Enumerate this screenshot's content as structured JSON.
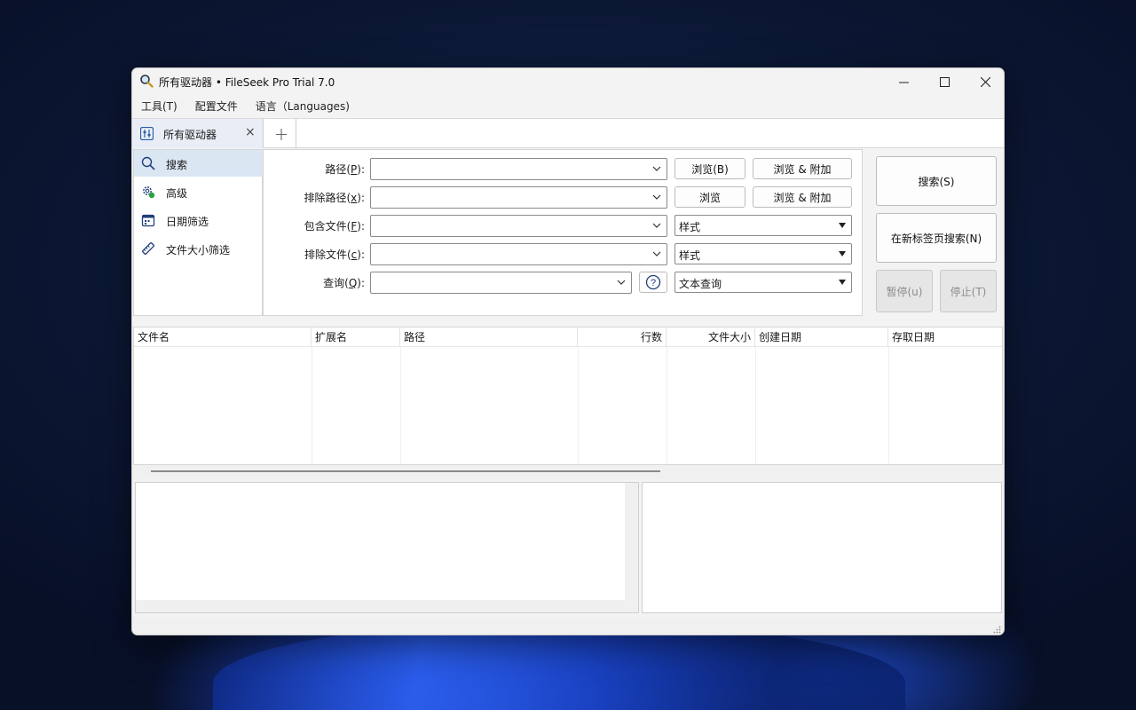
{
  "window": {
    "title": "所有驱动器 • FileSeek Pro Trial 7.0",
    "minimize_glyph": "—",
    "maximize_glyph": "☐",
    "close_glyph": "✕"
  },
  "menu": {
    "items": [
      {
        "label": "工具(T)"
      },
      {
        "label": "配置文件"
      },
      {
        "label": "语言（Languages)"
      }
    ]
  },
  "tabs": {
    "items": [
      {
        "label": "所有驱动器",
        "icon": "sliders-icon"
      }
    ],
    "close_glyph": "×",
    "add_glyph": "+"
  },
  "sidebar": {
    "items": [
      {
        "label": "搜索",
        "icon": "search-icon",
        "active": true
      },
      {
        "label": "高级",
        "icon": "gear-icon",
        "active": false
      },
      {
        "label": "日期筛选",
        "icon": "calendar-icon",
        "active": false
      },
      {
        "label": "文件大小筛选",
        "icon": "ruler-icon",
        "active": false
      }
    ]
  },
  "form": {
    "path": {
      "label_before": "路径(",
      "mnemonic": "P",
      "label_after": "):",
      "value": ""
    },
    "exclude_path": {
      "label_before": "排除路径(",
      "mnemonic": "x",
      "label_after": "):",
      "value": ""
    },
    "include_files": {
      "label_before": "包含文件(",
      "mnemonic": "F",
      "label_after": "):",
      "value": ""
    },
    "exclude_files": {
      "label_before": "排除文件(",
      "mnemonic": "c",
      "label_after": "):",
      "value": ""
    },
    "query": {
      "label_before": "查询(",
      "mnemonic": "Q",
      "label_after": "):",
      "value": ""
    },
    "browse_b": "浏览(B)",
    "browse_append_1": "浏览 & 附加",
    "browse": "浏览",
    "browse_append_2": "浏览 & 附加",
    "include_mode": "样式",
    "exclude_mode": "样式",
    "query_mode": "文本查询",
    "help_glyph": "?"
  },
  "actions": {
    "search": "搜索(S)",
    "search_new_tab": "在新标签页搜索(N)",
    "pause": "暂停(u)",
    "stop": "停止(T)"
  },
  "results": {
    "columns": [
      "文件名",
      "扩展名",
      "路径",
      "行数",
      "文件大小",
      "创建日期",
      "存取日期"
    ]
  }
}
